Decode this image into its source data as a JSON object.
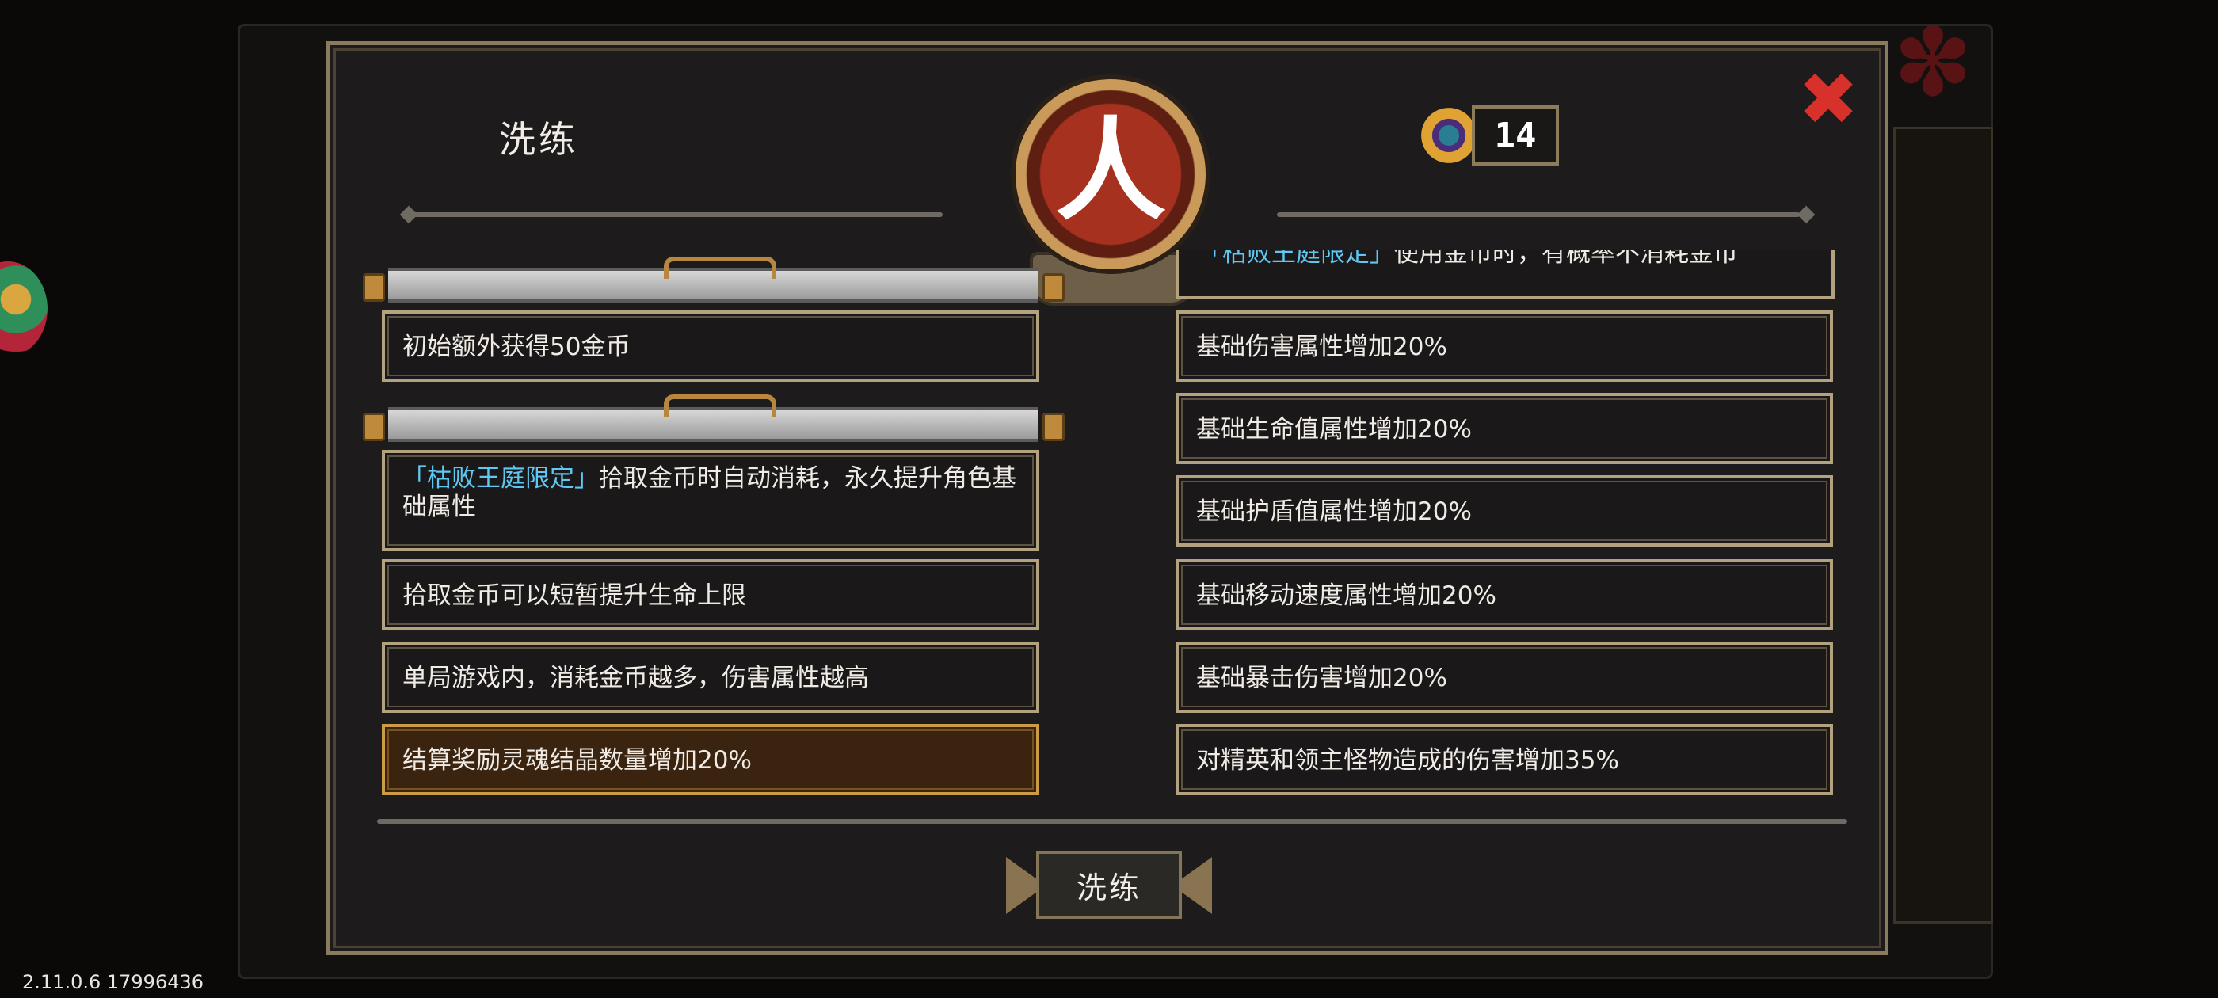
{
  "modal": {
    "title": "洗练",
    "emblem_char": "人",
    "currency": {
      "icon": "eye-gem-icon",
      "count": "14"
    },
    "close_icon": "close-icon"
  },
  "left_panel": {
    "slot1": {
      "option": "初始额外获得50金币"
    },
    "slot2": {
      "options": [
        {
          "tag": "「枯败王庭限定」",
          "text": "拾取金币时自动消耗，永久提升角色基础属性"
        },
        {
          "text": "拾取金币可以短暂提升生命上限"
        },
        {
          "text": "单局游戏内，消耗金币越多，伤害属性越高"
        },
        {
          "text": "结算奖励灵魂结晶数量增加20%",
          "selected": true
        }
      ]
    }
  },
  "right_panel": {
    "partial_top": {
      "tag": "「枯败王庭限定」",
      "text": "使用金币时，有概率不消耗金币"
    },
    "options": [
      "基础伤害属性增加20%",
      "基础生命值属性增加20%",
      "基础护盾值属性增加20%",
      "基础移动速度属性增加20%",
      "基础暴击伤害增加20%",
      "对精英和领主怪物造成的伤害增加35%"
    ]
  },
  "refine_button": {
    "label": "洗练"
  },
  "version": "2.11.0.6 17996436",
  "colors": {
    "accent_tag": "#5ec8f2",
    "close": "#d8302a",
    "selected_card": "#3a2410",
    "frame": "#8a7a5e"
  }
}
